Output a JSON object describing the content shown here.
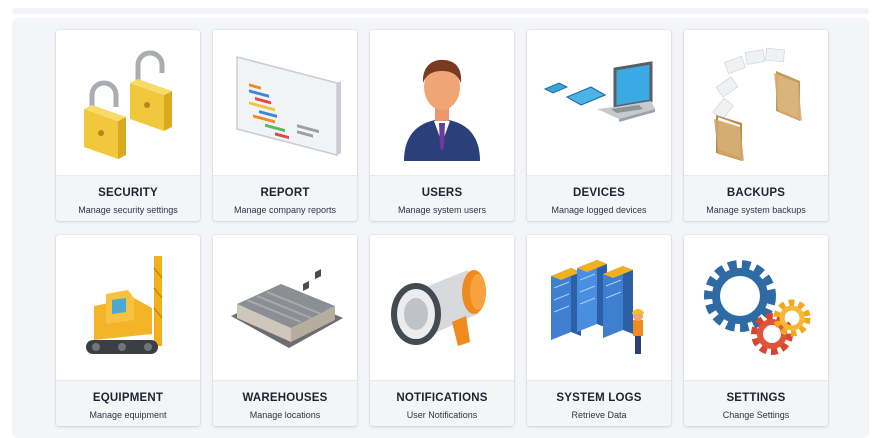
{
  "tiles": [
    {
      "title": "SECURITY",
      "subtitle": "Manage security settings",
      "icon": "padlock-icon"
    },
    {
      "title": "REPORT",
      "subtitle": "Manage company reports",
      "icon": "report-board-icon"
    },
    {
      "title": "USERS",
      "subtitle": "Manage system users",
      "icon": "user-avatar-icon"
    },
    {
      "title": "DEVICES",
      "subtitle": "Manage logged devices",
      "icon": "devices-icon"
    },
    {
      "title": "BACKUPS",
      "subtitle": "Manage system backups",
      "icon": "backup-folders-icon"
    },
    {
      "title": "EQUIPMENT",
      "subtitle": "Manage equipment",
      "icon": "drilling-rig-icon"
    },
    {
      "title": "WAREHOUSES",
      "subtitle": "Manage locations",
      "icon": "warehouse-icon"
    },
    {
      "title": "NOTIFICATIONS",
      "subtitle": "User Notifications",
      "icon": "megaphone-icon"
    },
    {
      "title": "SYSTEM LOGS",
      "subtitle": "Retrieve Data",
      "icon": "server-racks-icon"
    },
    {
      "title": "SETTINGS",
      "subtitle": "Change Settings",
      "icon": "gears-icon"
    }
  ],
  "colors": {
    "panel": "#f3f5f8",
    "caption": "#f4f5f7",
    "title_text": "#1d2330"
  }
}
